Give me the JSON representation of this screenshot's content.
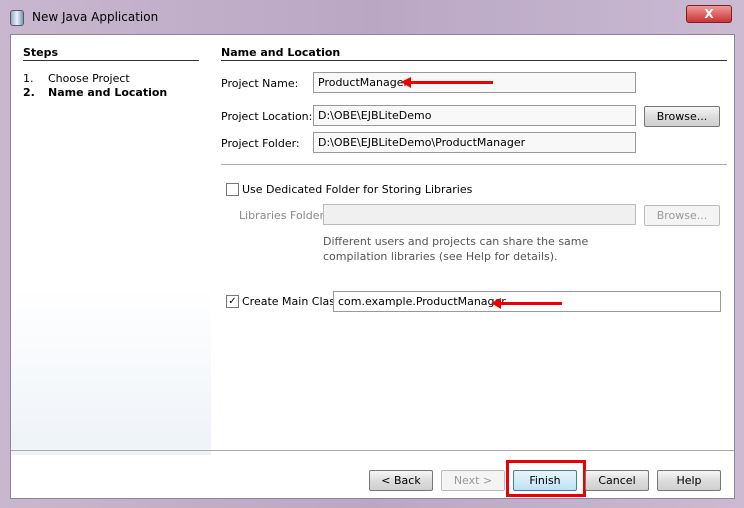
{
  "window": {
    "title": "New Java Application",
    "close": "X"
  },
  "steps": {
    "header": "Steps",
    "items": [
      {
        "num": "1.",
        "label": "Choose Project"
      },
      {
        "num": "2.",
        "label": "Name and Location"
      }
    ]
  },
  "panel": {
    "header": "Name and Location",
    "project_name_label": "Project Name:",
    "project_name": "ProductManager",
    "project_location_label": "Project Location:",
    "project_location": "D:\\OBE\\EJBLiteDemo",
    "project_folder_label": "Project Folder:",
    "project_folder": "D:\\OBE\\EJBLiteDemo\\ProductManager",
    "browse": "Browse...",
    "dedicated_label": "Use Dedicated Folder for Storing Libraries",
    "dedicated_checked": false,
    "libraries_label": "Libraries Folder:",
    "libraries_value": "",
    "libraries_browse": "Browse...",
    "hint": "Different users and projects can share the same compilation libraries (see Help for details).",
    "main_class_label": "Create Main Class",
    "main_class_checked": true,
    "main_class": "com.example.ProductManager"
  },
  "buttons": {
    "back": "< Back",
    "next": "Next >",
    "finish": "Finish",
    "cancel": "Cancel",
    "help": "Help"
  }
}
